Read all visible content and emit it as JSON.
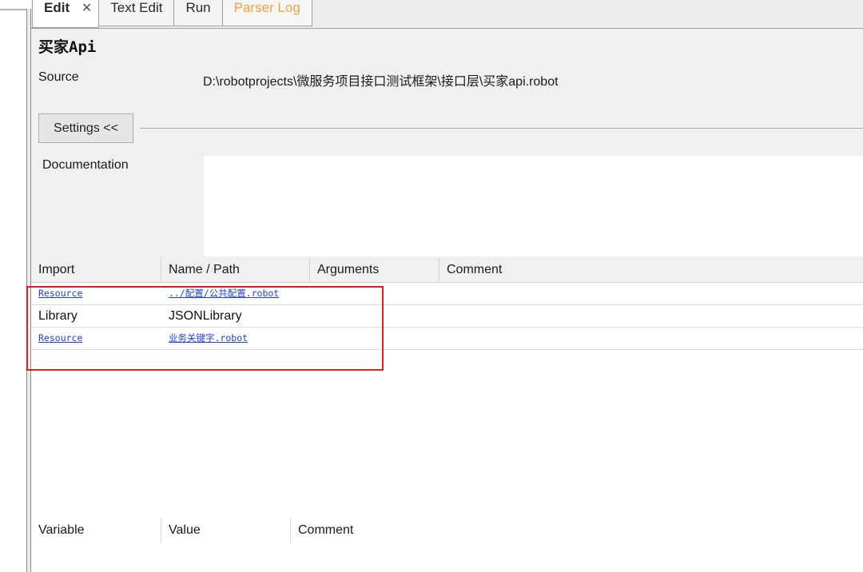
{
  "tabs": [
    {
      "label": "Edit",
      "active": true,
      "closable": true,
      "close_glyph": "✕"
    },
    {
      "label": "Text Edit",
      "active": false
    },
    {
      "label": "Run",
      "active": false
    },
    {
      "label": "Parser Log",
      "active": false,
      "color": "#f1a23a"
    }
  ],
  "file": {
    "title": "买家Api",
    "source_label": "Source",
    "source_path": "D:\\robotprojects\\微服务项目接口测试框架\\接口层\\买家api.robot"
  },
  "settings": {
    "toggle_label": "Settings <<",
    "documentation_label": "Documentation",
    "documentation_value": ""
  },
  "imports": {
    "columns": [
      "Import",
      "Name / Path",
      "Arguments",
      "Comment"
    ],
    "rows": [
      {
        "type": "Resource",
        "name": "../配置/公共配置.robot",
        "is_link": true
      },
      {
        "type": "Library",
        "name": "JSONLibrary",
        "is_link": false
      },
      {
        "type": "Resource",
        "name": "业务关键字.robot",
        "is_link": true
      }
    ]
  },
  "variables": {
    "columns": [
      "Variable",
      "Value",
      "Comment"
    ]
  },
  "colors": {
    "link": "#1f3fd6",
    "highlight_border": "#e02020",
    "parser_log_tab": "#f1a23a",
    "panel_bg": "#f0f0f0"
  }
}
